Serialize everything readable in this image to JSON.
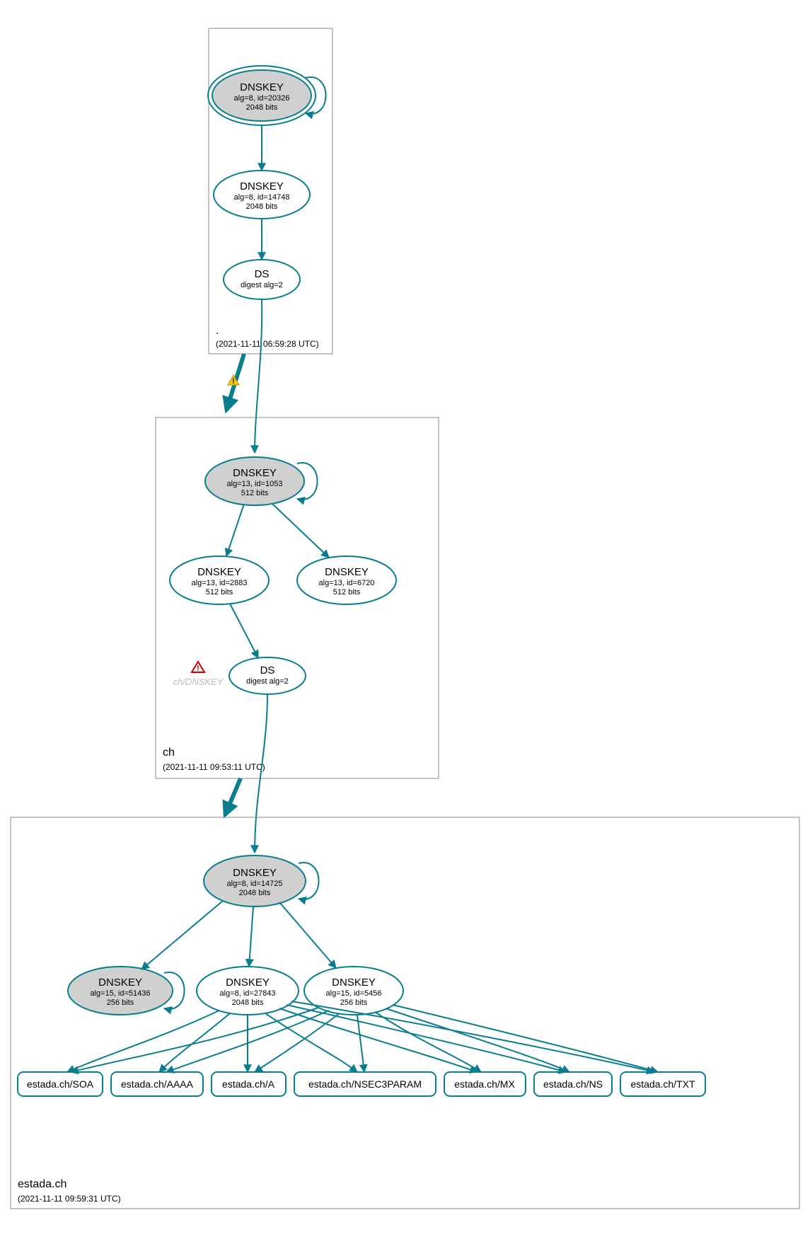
{
  "colors": {
    "stroke": "#0a7e8c",
    "grey_fill": "#d0d0d0",
    "box_stroke": "#888888"
  },
  "zones": [
    {
      "id": "root",
      "name_label": ".",
      "timestamp": "(2021-11-11 06:59:28 UTC)",
      "nodes": [
        {
          "id": "root_ksk",
          "title": "DNSKEY",
          "line2": "alg=8, id=20326",
          "line3": "2048 bits",
          "grey": true,
          "double": true
        },
        {
          "id": "root_zsk",
          "title": "DNSKEY",
          "line2": "alg=8, id=14748",
          "line3": "2048 bits",
          "grey": false,
          "double": false
        },
        {
          "id": "root_ds",
          "title": "DS",
          "line2": "digest alg=2",
          "line3": "",
          "grey": false,
          "double": false
        }
      ]
    },
    {
      "id": "ch",
      "name_label": "ch",
      "timestamp": "(2021-11-11 09:53:11 UTC)",
      "warning_label": "ch/DNSKEY",
      "nodes": [
        {
          "id": "ch_ksk",
          "title": "DNSKEY",
          "line2": "alg=13, id=1053",
          "line3": "512 bits",
          "grey": true,
          "double": false
        },
        {
          "id": "ch_zsk1",
          "title": "DNSKEY",
          "line2": "alg=13, id=2883",
          "line3": "512 bits",
          "grey": false,
          "double": false
        },
        {
          "id": "ch_zsk2",
          "title": "DNSKEY",
          "line2": "alg=13, id=6720",
          "line3": "512 bits",
          "grey": false,
          "double": false
        },
        {
          "id": "ch_ds",
          "title": "DS",
          "line2": "digest alg=2",
          "line3": "",
          "grey": false,
          "double": false
        }
      ]
    },
    {
      "id": "estada",
      "name_label": "estada.ch",
      "timestamp": "(2021-11-11 09:59:31 UTC)",
      "nodes": [
        {
          "id": "est_ksk",
          "title": "DNSKEY",
          "line2": "alg=8, id=14725",
          "line3": "2048 bits",
          "grey": true,
          "double": false
        },
        {
          "id": "est_k15a",
          "title": "DNSKEY",
          "line2": "alg=15, id=51436",
          "line3": "256 bits",
          "grey": true,
          "double": false
        },
        {
          "id": "est_k8",
          "title": "DNSKEY",
          "line2": "alg=8, id=27843",
          "line3": "2048 bits",
          "grey": false,
          "double": false
        },
        {
          "id": "est_k15b",
          "title": "DNSKEY",
          "line2": "alg=15, id=5456",
          "line3": "256 bits",
          "grey": false,
          "double": false
        }
      ],
      "rrsets": [
        {
          "id": "rr_soa",
          "label": "estada.ch/SOA"
        },
        {
          "id": "rr_aaaa",
          "label": "estada.ch/AAAA"
        },
        {
          "id": "rr_a",
          "label": "estada.ch/A"
        },
        {
          "id": "rr_nsec3",
          "label": "estada.ch/NSEC3PARAM"
        },
        {
          "id": "rr_mx",
          "label": "estada.ch/MX"
        },
        {
          "id": "rr_ns",
          "label": "estada.ch/NS"
        },
        {
          "id": "rr_txt",
          "label": "estada.ch/TXT"
        }
      ]
    }
  ],
  "zone_delegation_warning_icon": "warning-triangle-yellow",
  "error_icon": "error-triangle-red"
}
